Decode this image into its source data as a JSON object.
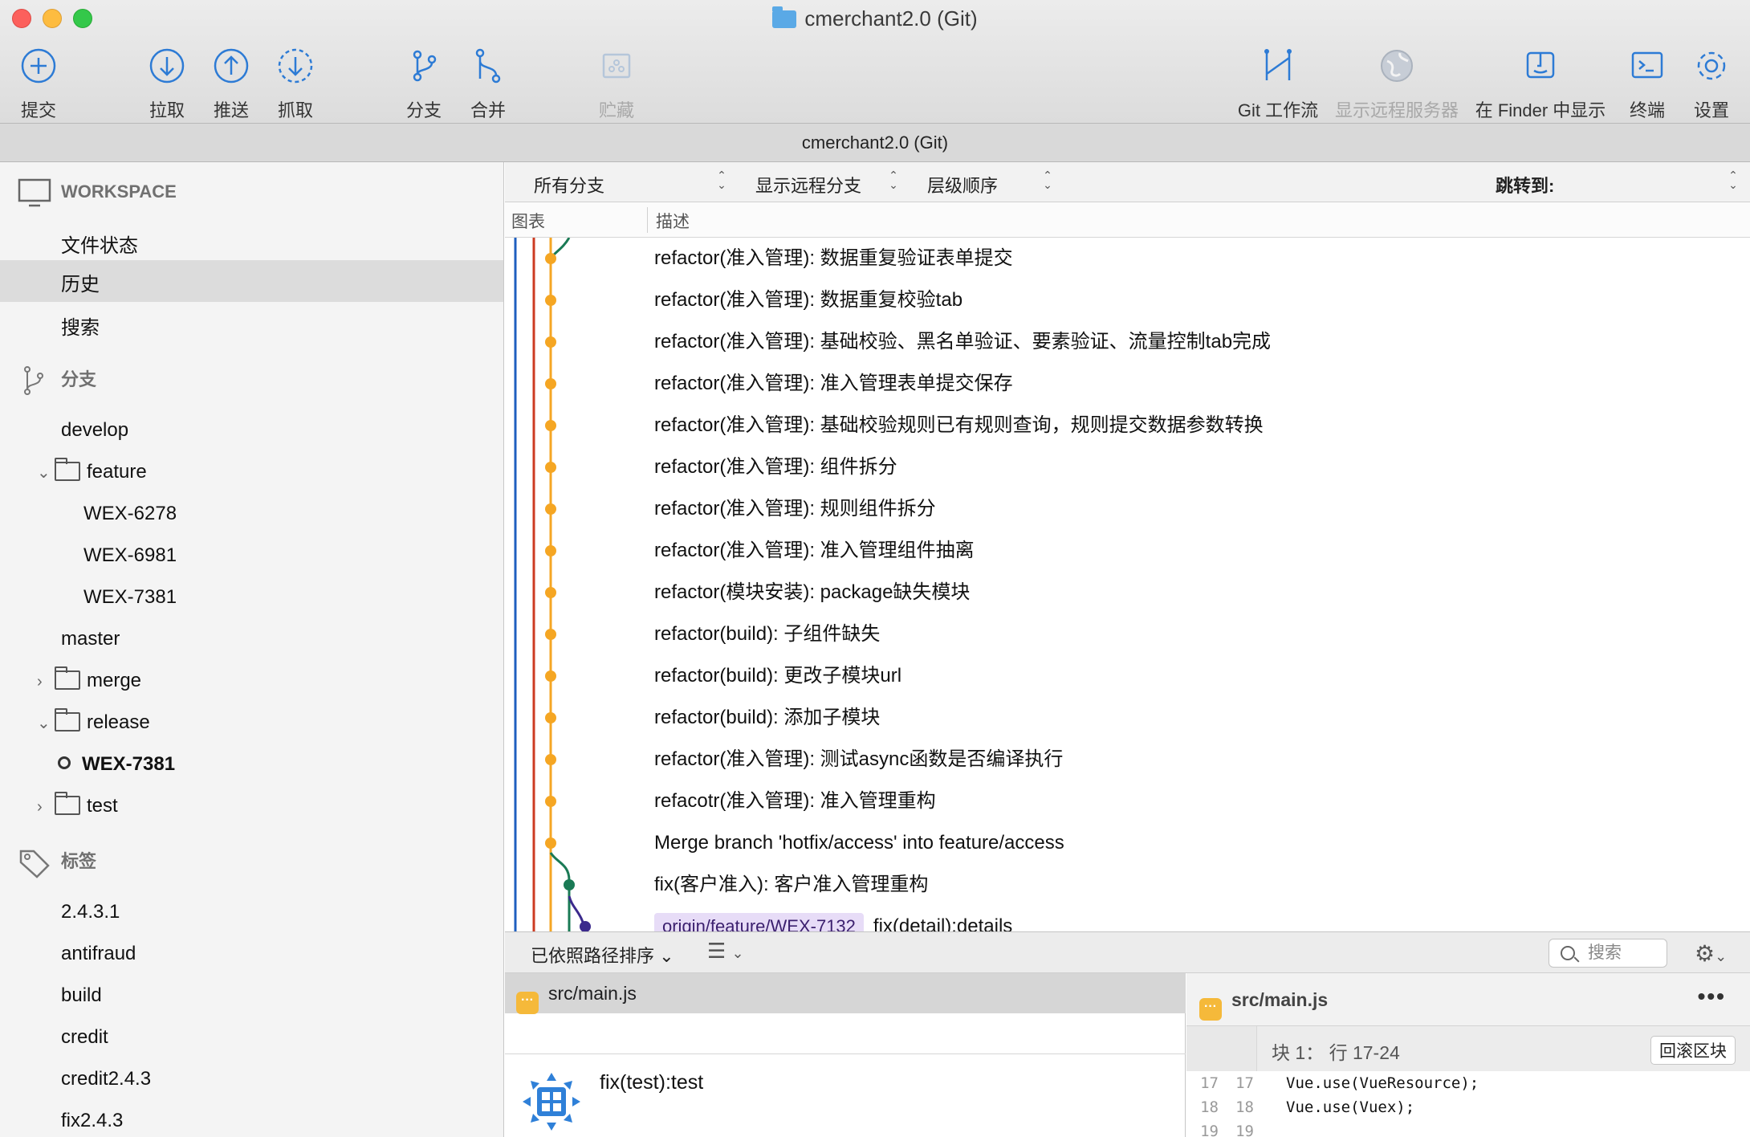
{
  "window": {
    "title": "cmerchant2.0 (Git)",
    "tab_title": "cmerchant2.0 (Git)"
  },
  "toolbar": {
    "commit": "提交",
    "pull": "拉取",
    "push": "推送",
    "fetch": "抓取",
    "branch": "分支",
    "merge": "合并",
    "stash": "贮藏",
    "git_flow": "Git 工作流",
    "show_remote": "显示远程服务器",
    "show_in_finder": "在 Finder 中显示",
    "terminal": "终端",
    "settings": "设置"
  },
  "sidebar": {
    "workspace": "WORKSPACE",
    "workspace_items": [
      "文件状态",
      "历史",
      "搜索"
    ],
    "branches_header": "分支",
    "branches": {
      "develop": "develop",
      "feature": "feature",
      "feature_children": [
        "WEX-6278",
        "WEX-6981",
        "WEX-7381"
      ],
      "master": "master",
      "merge": "merge",
      "release": "release",
      "release_current": "WEX-7381",
      "test": "test"
    },
    "tags_header": "标签",
    "tags": [
      "2.4.3.1",
      "antifraud",
      "build",
      "credit",
      "credit2.4.3",
      "fix2.4.3"
    ]
  },
  "filters": {
    "branches": "所有分支",
    "remote": "显示远程分支",
    "order": "层级顺序",
    "jump": "跳转到:"
  },
  "columns": {
    "graph": "图表",
    "description": "描述"
  },
  "commits": [
    "refactor(准入管理):  数据重复验证表单提交",
    "refactor(准入管理): 数据重复校验tab",
    "refactor(准入管理): 基础校验、黑名单验证、要素验证、流量控制tab完成",
    "refactor(准入管理):  准入管理表单提交保存",
    "refactor(准入管理): 基础校验规则已有规则查询，规则提交数据参数转换",
    "refactor(准入管理): 组件拆分",
    "refactor(准入管理): 规则组件拆分",
    "refactor(准入管理): 准入管理组件抽离",
    "refactor(模块安装): package缺失模块",
    "refactor(build): 子组件缺失",
    "refactor(build): 更改子模块url",
    "refactor(build): 添加子模块",
    "refactor(准入管理): 测试async函数是否编译执行",
    "refacotr(准入管理): 准入管理重构",
    "Merge branch 'hotfix/access' into feature/access",
    "fix(客户准入):  客户准入管理重构"
  ],
  "partial_commit": {
    "tag": "origin/feature/WEX-7132",
    "message": "fix(detail):details"
  },
  "lower": {
    "sort": "已依照路径排序",
    "search_placeholder": "搜索"
  },
  "file": {
    "name": "src/main.js",
    "commit_message": "fix(test):test"
  },
  "diff": {
    "file": "src/main.js",
    "hunk": "块 1： 行 17-24",
    "revert": "回滚区块",
    "lines": [
      {
        "old": "17",
        "new": "17",
        "code": "Vue.use(VueResource);"
      },
      {
        "old": "18",
        "new": "18",
        "code": "Vue.use(Vuex);"
      },
      {
        "old": "19",
        "new": "19",
        "code": ""
      }
    ]
  },
  "colors": {
    "lane_blue": "#1f5fbf",
    "lane_red": "#cc3b22",
    "lane_orange": "#f5a623",
    "lane_green": "#1a7a55",
    "lane_purple": "#3b2a8c"
  }
}
